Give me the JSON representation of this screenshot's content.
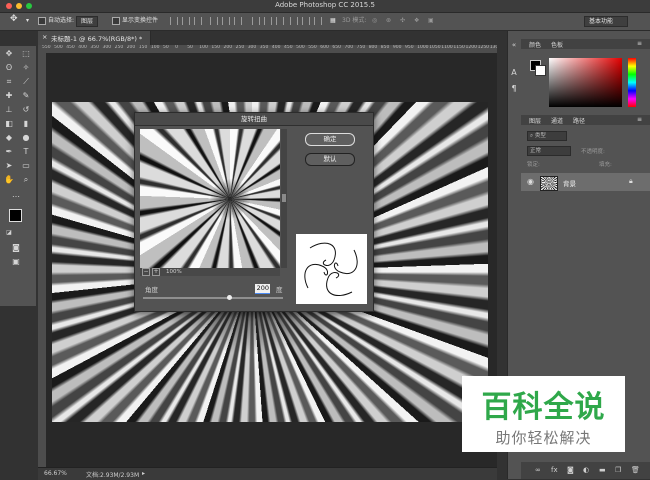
{
  "window": {
    "title": "Adobe Photoshop CC 2015.5",
    "traffic_colors": [
      "#fc5f57",
      "#fdbc2e",
      "#28c840"
    ]
  },
  "options_bar": {
    "auto_select_label": "自动选择:",
    "auto_select_value": "图层",
    "show_transform_label": "显示变换控件",
    "mode_3d": "3D 模式:",
    "workspace": "基本功能"
  },
  "document": {
    "tab_label": "未标题-1 @ 66.7%(RGB/8*) *",
    "ruler_ticks": [
      "550",
      "500",
      "450",
      "400",
      "350",
      "300",
      "250",
      "200",
      "150",
      "100",
      "50",
      "0",
      "50",
      "100",
      "150",
      "200",
      "250",
      "300",
      "350",
      "400",
      "450",
      "500",
      "550",
      "600",
      "650",
      "700",
      "750",
      "800",
      "850",
      "900",
      "950",
      "1000",
      "1050",
      "1100",
      "1150",
      "1200",
      "1250",
      "1300"
    ]
  },
  "status": {
    "zoom": "66.67%",
    "doc_size": "文档:2.93M/2.93M"
  },
  "dialog": {
    "title": "旋转扭曲",
    "ok_label": "确定",
    "reset_label": "默认",
    "preview_zoom": "100%",
    "zoom_out": "−",
    "zoom_in": "+",
    "angle_label": "角度",
    "angle_value": "200",
    "angle_unit": "度",
    "angle": 200
  },
  "panels": {
    "color_tabs": [
      "颜色",
      "色板"
    ],
    "layer_tabs": [
      "图层",
      "通道",
      "路径"
    ],
    "kind_label": "类型",
    "blend_mode": "正常",
    "opacity_label": "不透明度:",
    "lock_label": "锁定:",
    "fill_label": "填充:",
    "layer_name": "背景"
  },
  "tools": [
    "move-icon",
    "marquee-icon",
    "lasso-icon",
    "magic-wand-icon",
    "crop-icon",
    "eyedropper-icon",
    "healing-icon",
    "brush-icon",
    "stamp-icon",
    "history-brush-icon",
    "eraser-icon",
    "gradient-icon",
    "blur-icon",
    "dodge-icon",
    "pen-icon",
    "type-icon",
    "path-select-icon",
    "shape-icon",
    "hand-icon",
    "zoom-icon"
  ],
  "watermark": {
    "main": "百科全说",
    "sub": "助你轻松解决",
    "color": "#2fa84a"
  }
}
